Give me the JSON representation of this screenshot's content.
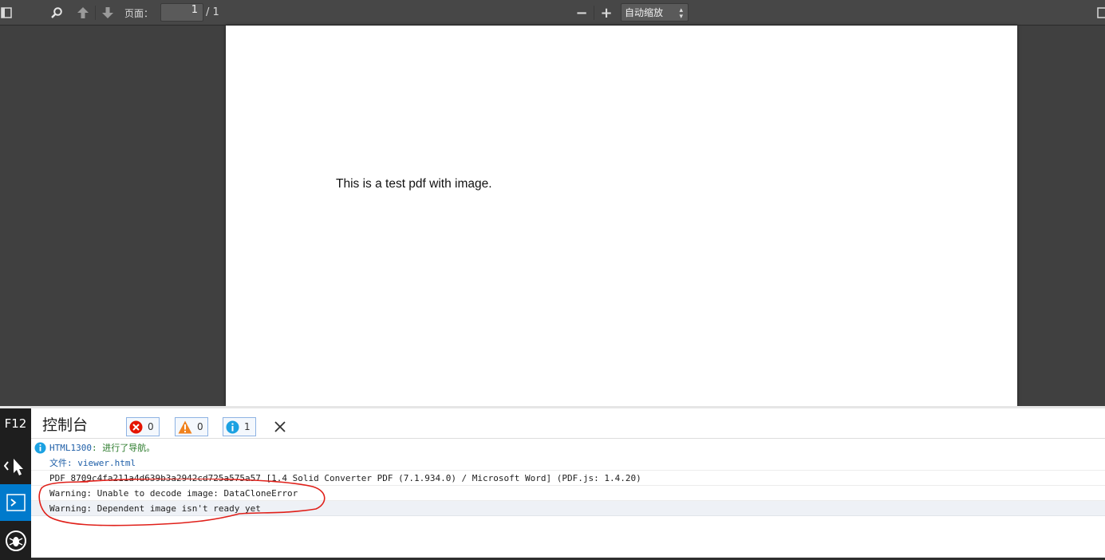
{
  "toolbar": {
    "page_label": "页面：",
    "page_value": "1",
    "page_total": "/ 1",
    "zoom_minus": "−",
    "zoom_plus": "+",
    "zoom_value": "自动缩放"
  },
  "document": {
    "text": "This is a test pdf with image."
  },
  "devtools": {
    "f12_label": "F12",
    "console_title": "控制台",
    "error_count": "0",
    "warning_count": "0",
    "info_count": "1",
    "messages": [
      {
        "code": "HTML1300",
        "text": ": 进行了导航。"
      },
      {
        "text": "文件: viewer.html"
      },
      {
        "text": "PDF 8709c4fa211a4d639b3a2942cd725a575a57 [1.4 Solid Converter PDF  (7.1.934.0) / Microsoft Word] (PDF.js: 1.4.20)"
      },
      {
        "text": "Warning: Unable to decode image: DataCloneError"
      },
      {
        "text": "Warning: Dependent image isn't ready yet"
      }
    ]
  },
  "colors": {
    "toolbar_bg": "#474747",
    "viewer_bg": "#404040",
    "dev_sidebar_bg": "#1e1e1e",
    "active_tool": "#007acc",
    "annotation": "#e0201a"
  },
  "icons": [
    "sidebar-toggle-icon",
    "search-icon",
    "arrow-up-icon",
    "arrow-down-icon",
    "presentation-icon",
    "inspect-icon",
    "console-icon",
    "debugger-icon",
    "error-icon",
    "warning-icon",
    "info-icon",
    "close-icon"
  ]
}
